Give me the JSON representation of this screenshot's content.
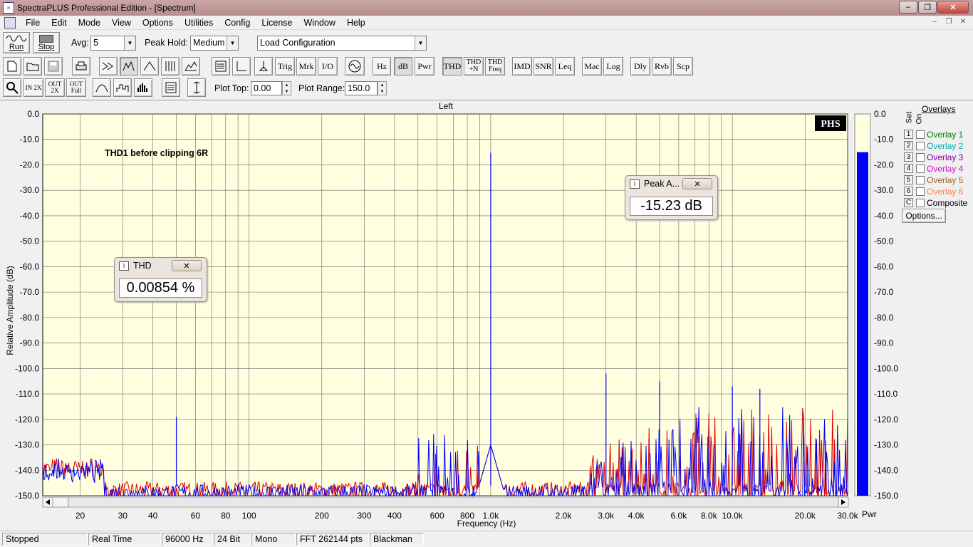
{
  "window": {
    "title": "SpectraPLUS Professional Edition - [Spectrum]"
  },
  "menu": [
    "File",
    "Edit",
    "Mode",
    "View",
    "Options",
    "Utilities",
    "Config",
    "License",
    "Window",
    "Help"
  ],
  "toolbar1": {
    "run_label": "Run",
    "stop_label": "Stop",
    "avg_label": "Avg:",
    "avg_value": "5",
    "peak_hold_label": "Peak Hold:",
    "peak_hold_value": "Medium",
    "config_value": "Load Configuration"
  },
  "toolbar2": {
    "text_buttons": [
      "Trig",
      "Mrk",
      "I/O",
      "Hz",
      "dB",
      "Pwr",
      "THD",
      "THD +N",
      "THD Freq",
      "IMD",
      "SNR",
      "Leq",
      "Mac",
      "Log",
      "Dly",
      "Rvb",
      "Scp"
    ]
  },
  "toolbar3": {
    "zoom_buttons": [
      "IN 2X",
      "OUT 2X",
      "OUT Full"
    ],
    "plot_top_label": "Plot Top:",
    "plot_top_value": "0.00",
    "plot_range_label": "Plot Range:",
    "plot_range_value": "150.0"
  },
  "plot": {
    "channel_title": "Left",
    "annotation": "THD1 before clipping 6R",
    "logo": "PHS",
    "ylabel": "Relative Amplitude (dB)",
    "xlabel": "Frequency (Hz)",
    "y_ticks": [
      "0.0",
      "-10.0",
      "-20.0",
      "-30.0",
      "-40.0",
      "-50.0",
      "-60.0",
      "-70.0",
      "-80.0",
      "-90.0",
      "-100.0",
      "-110.0",
      "-120.0",
      "-130.0",
      "-140.0",
      "-150.0"
    ],
    "x_ticks": [
      "20",
      "30",
      "40",
      "60",
      "80",
      "100",
      "200",
      "300",
      "400",
      "600",
      "800",
      "1.0k",
      "2.0k",
      "3.0k",
      "4.0k",
      "6.0k",
      "8.0k",
      "10.0k",
      "20.0k",
      "30.0k"
    ],
    "pwr_label": "Pwr",
    "pwr_ticks": [
      "0.0",
      "-10.0",
      "-20.0",
      "-30.0",
      "-40.0",
      "-50.0",
      "-60.0",
      "-70.0",
      "-80.0",
      "-90.0",
      "-100.0",
      "-110.0",
      "-120.0",
      "-130.0",
      "-140.0",
      "-150.0"
    ],
    "colors": {
      "plot_bg": "#ffffe0",
      "series_blue": "#0000ff",
      "series_red": "#dd0000",
      "pwr_bar": "#0000ff"
    }
  },
  "chart_data": {
    "type": "line",
    "title": "Left",
    "xlabel": "Frequency (Hz)",
    "ylabel": "Relative Amplitude (dB)",
    "xscale": "log",
    "xlim": [
      14,
      30000
    ],
    "ylim": [
      -150,
      0
    ],
    "grid": true,
    "annotations": [
      "THD1 before clipping 6R"
    ],
    "peaks": [
      {
        "x": 50,
        "y": -119
      },
      {
        "x": 1000,
        "y": -15.23
      },
      {
        "x": 3000,
        "y": -102
      },
      {
        "x": 5000,
        "y": -105
      },
      {
        "x": 10000,
        "y": -107
      },
      {
        "x": 13000,
        "y": -108
      }
    ],
    "noise_floor_db": -145,
    "pwr_level_db": -15
  },
  "thd_popup": {
    "title": "THD",
    "value": "0.00854 %"
  },
  "peak_popup": {
    "title": "Peak A...",
    "value": "-15.23 dB"
  },
  "overlays": {
    "header": "Overlays",
    "set_label": "Set",
    "on_label": "On",
    "items": [
      {
        "set": "1",
        "label": "Overlay 1",
        "color": "#008000"
      },
      {
        "set": "2",
        "label": "Overlay 2",
        "color": "#00b0b0"
      },
      {
        "set": "3",
        "label": "Overlay 3",
        "color": "#8000a0"
      },
      {
        "set": "4",
        "label": "Overlay 4",
        "color": "#e000e0"
      },
      {
        "set": "5",
        "label": "Overlay 5",
        "color": "#a06020"
      },
      {
        "set": "6",
        "label": "Overlay 6",
        "color": "#ff8040"
      },
      {
        "set": "C",
        "label": "Composite",
        "color": "#000000"
      }
    ],
    "options_label": "Options..."
  },
  "status": [
    "Stopped",
    "Real Time",
    "96000 Hz",
    "24 Bit",
    "Mono",
    "FFT 262144 pts",
    "Blackman"
  ]
}
